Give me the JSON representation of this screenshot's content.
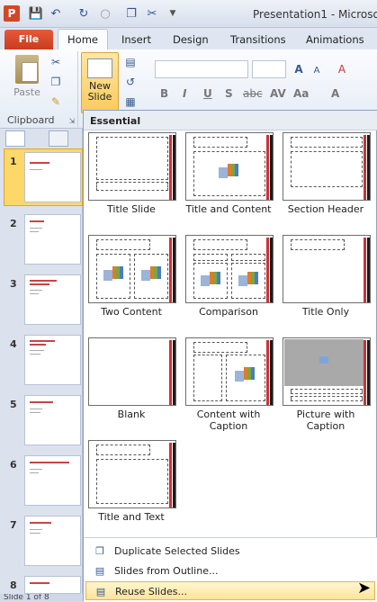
{
  "window": {
    "app_icon": "P",
    "title": "Presentation1  -  Microso"
  },
  "quick_access": {
    "save_icon": "save-icon",
    "undo_icon": "undo-icon",
    "redo_icon": "repeat-icon"
  },
  "tabs": [
    "File",
    "Home",
    "Insert",
    "Design",
    "Transitions",
    "Animations"
  ],
  "ribbon": {
    "paste_label": "Paste",
    "clipboard_label": "Clipboard",
    "new_slide_label_1": "New",
    "new_slide_label_2": "Slide",
    "format_glyphs": [
      "B",
      "I",
      "U",
      "S",
      "abc",
      "AV",
      "Aa",
      "A"
    ]
  },
  "slides_panel": {
    "numbers": [
      "1",
      "2",
      "3",
      "4",
      "5",
      "6",
      "7",
      "8"
    ],
    "status": "Slide 1 of 8"
  },
  "gallery": {
    "header": "Essential",
    "layouts": [
      {
        "name": "Title Slide"
      },
      {
        "name": "Title and Content"
      },
      {
        "name": "Section Header"
      },
      {
        "name": "Two Content"
      },
      {
        "name": "Comparison"
      },
      {
        "name": "Title Only"
      },
      {
        "name": "Blank"
      },
      {
        "name": "Content with Caption"
      },
      {
        "name": "Picture with Caption"
      },
      {
        "name": "Title and Text"
      }
    ]
  },
  "menu": {
    "duplicate": "Duplicate Selected Slides",
    "outline": "Slides from Outline...",
    "reuse": "Reuse Slides..."
  },
  "colors": {
    "accent": "#c93c1e",
    "highlight": "#fcd86a"
  }
}
